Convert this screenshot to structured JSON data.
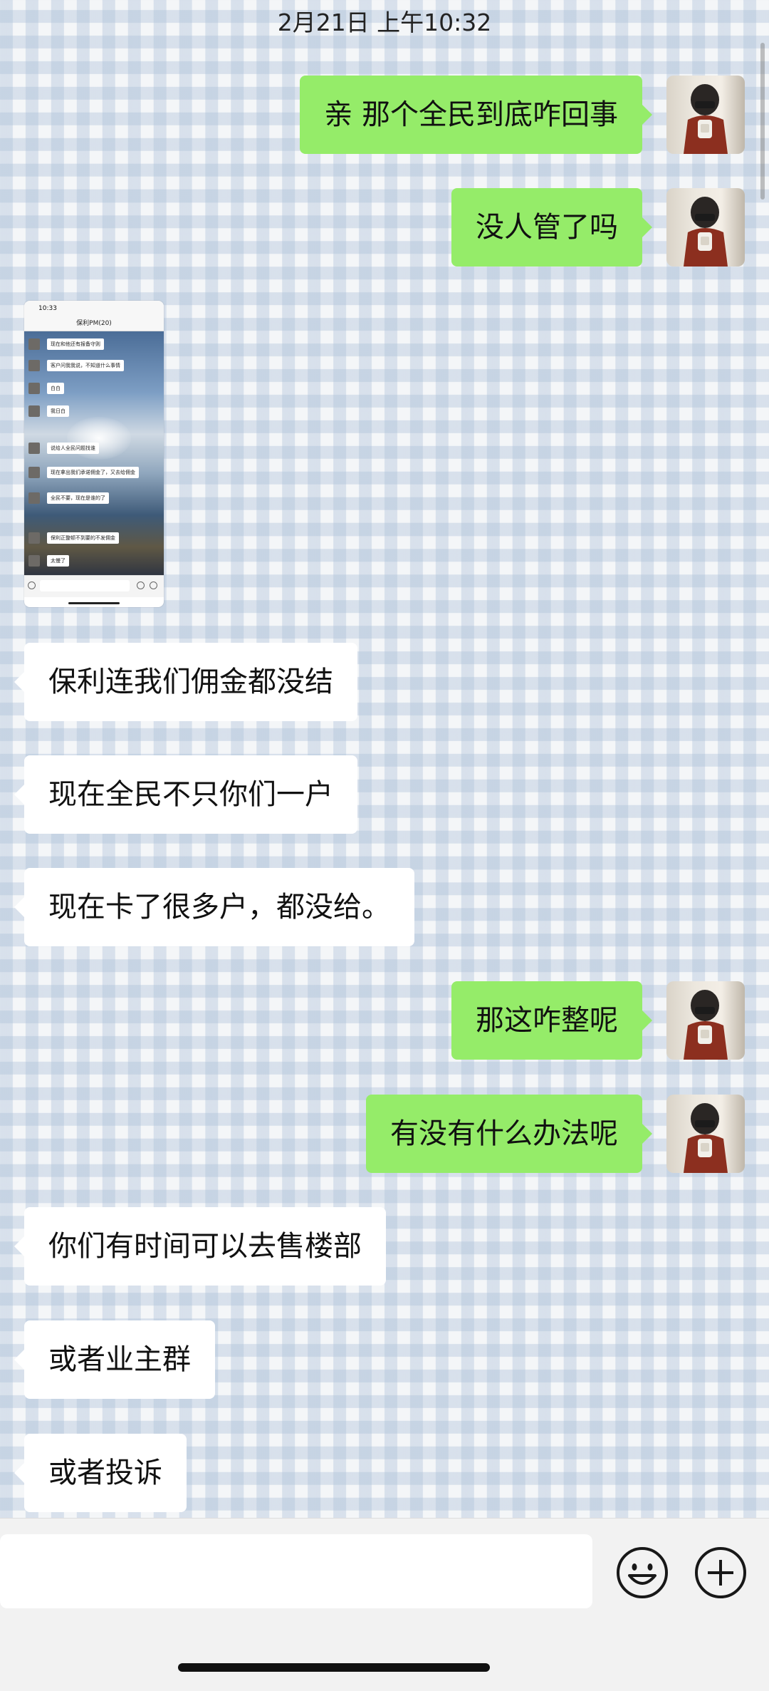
{
  "header": {
    "timestamp": "2月21日 上午10:32"
  },
  "messages": [
    {
      "id": 1,
      "direction": "out",
      "text": "亲 那个全民到底咋回事"
    },
    {
      "id": 2,
      "direction": "out",
      "text": "没人管了吗"
    },
    {
      "id": 3,
      "direction": "in",
      "type": "image"
    },
    {
      "id": 4,
      "direction": "in",
      "text": "保利连我们佣金都没结"
    },
    {
      "id": 5,
      "direction": "in",
      "text": "现在全民不只你们一户"
    },
    {
      "id": 6,
      "direction": "in",
      "text": "现在卡了很多户，都没给。"
    },
    {
      "id": 7,
      "direction": "out",
      "text": "那这咋整呢"
    },
    {
      "id": 8,
      "direction": "out",
      "text": "有没有什么办法呢"
    },
    {
      "id": 9,
      "direction": "in",
      "text": "你们有时间可以去售楼部"
    },
    {
      "id": 10,
      "direction": "in",
      "text": "或者业主群"
    },
    {
      "id": 11,
      "direction": "in",
      "text": "或者投诉"
    }
  ],
  "image_preview": {
    "status_time": "10:33",
    "title": "保利PM(20)",
    "lines": [
      "现在和他还有报备守则",
      "客户问我我说，不知道什么事情",
      "白白",
      "我日白",
      "说给人全民问题找谁",
      "现在拿出我们承诺佣金了，又去给佣金",
      "全民不要，现在是谁的了",
      "保利正整顿不到要的不发佣金",
      "太慢了"
    ]
  },
  "input_bar": {
    "placeholder": "",
    "emoji_icon": "smiley-face-icon",
    "more_icon": "plus-circle-icon"
  },
  "colors": {
    "outgoing_bubble": "#95ec69",
    "incoming_bubble": "#ffffff"
  }
}
